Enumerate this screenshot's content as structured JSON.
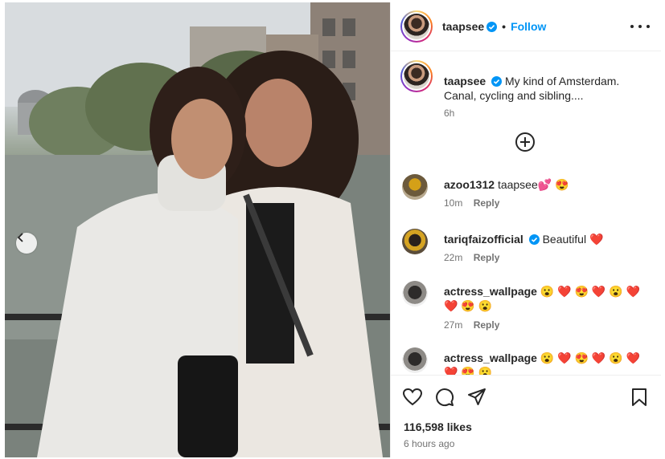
{
  "post": {
    "username": "taapsee",
    "follow_label": "Follow",
    "separator": "•",
    "caption_text": "My kind of Amsterdam. Canal, cycling and sibling....",
    "caption_time": "6h",
    "likes": "116,598 likes",
    "time_ago": "6 hours ago"
  },
  "comments": [
    {
      "username": "azoo1312",
      "text": "taapsee💕 😍",
      "time": "10m",
      "reply_label": "Reply",
      "verified": false
    },
    {
      "username": "tariqfaizofficial",
      "text": "Beautiful ❤️",
      "time": "22m",
      "reply_label": "Reply",
      "verified": true
    },
    {
      "username": "actress_wallpage",
      "text": "😮 ❤️ 😍 ❤️ 😮 ❤️ ❤️ 😍 😮",
      "time": "27m",
      "reply_label": "Reply",
      "verified": false
    },
    {
      "username": "actress_wallpage",
      "text": "😮 ❤️ 😍 ❤️ 😮 ❤️ ❤️ 😍 😮",
      "time": "",
      "reply_label": "",
      "verified": false
    }
  ],
  "icons": [
    "verified-badge-icon",
    "more-options-icon",
    "add-comment-icon",
    "heart-icon",
    "comment-icon",
    "share-icon",
    "save-bookmark-icon",
    "chevron-left-icon"
  ],
  "colors": {
    "accent": "#0095f6",
    "text": "#262626",
    "muted": "#737373",
    "border": "#efefef"
  }
}
